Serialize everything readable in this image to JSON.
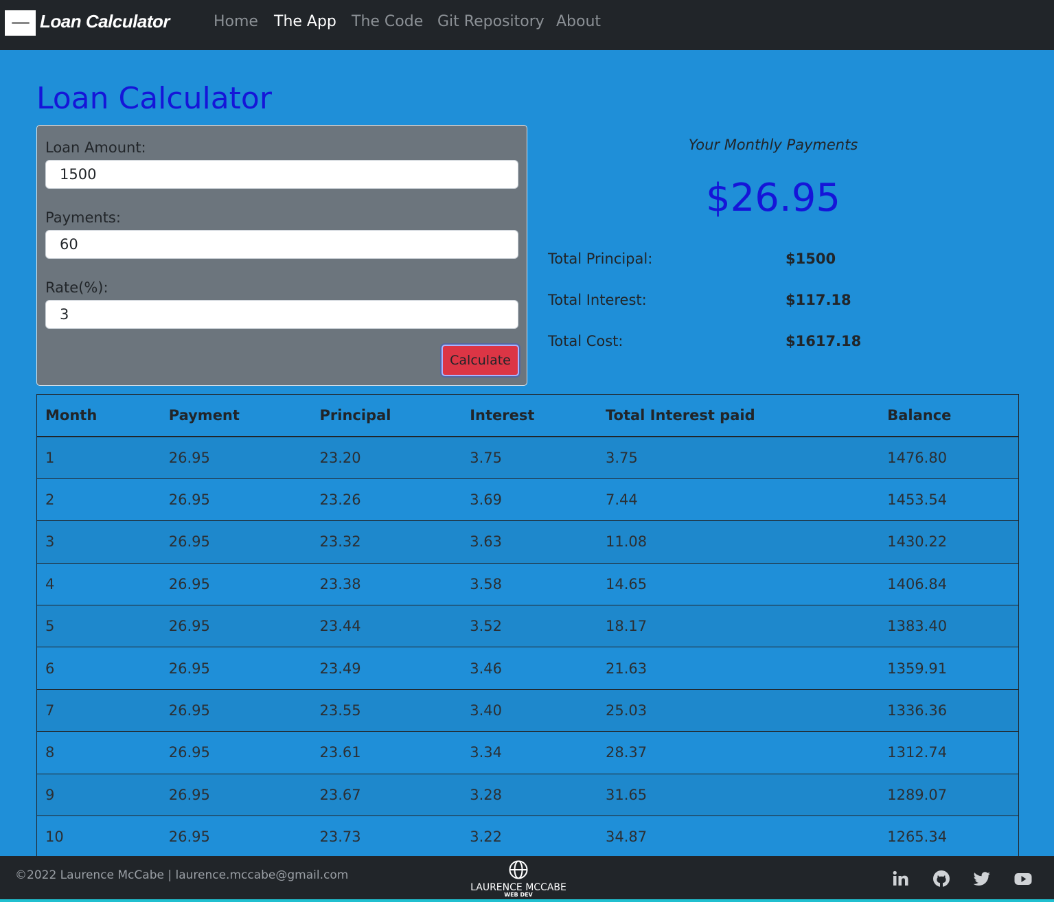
{
  "nav": {
    "brand": "Loan Calculator",
    "links": [
      "Home",
      "The App",
      "The Code",
      "Git Repository",
      "About"
    ],
    "active_index": 1
  },
  "page": {
    "title": "Loan Calculator"
  },
  "form": {
    "loan_amount_label": "Loan Amount:",
    "loan_amount_value": "1500",
    "payments_label": "Payments:",
    "payments_value": "60",
    "rate_label": "Rate(%):",
    "rate_value": "3",
    "calculate_label": "Calculate"
  },
  "results": {
    "caption": "Your Monthly Payments",
    "monthly_payment": "$26.95",
    "total_principal_label": "Total Principal:",
    "total_principal_value": "$1500",
    "total_interest_label": "Total Interest:",
    "total_interest_value": "$117.18",
    "total_cost_label": "Total Cost:",
    "total_cost_value": "$1617.18"
  },
  "table": {
    "headers": [
      "Month",
      "Payment",
      "Principal",
      "Interest",
      "Total Interest paid",
      "Balance"
    ],
    "rows": [
      [
        "1",
        "26.95",
        "23.20",
        "3.75",
        "3.75",
        "1476.80"
      ],
      [
        "2",
        "26.95",
        "23.26",
        "3.69",
        "7.44",
        "1453.54"
      ],
      [
        "3",
        "26.95",
        "23.32",
        "3.63",
        "11.08",
        "1430.22"
      ],
      [
        "4",
        "26.95",
        "23.38",
        "3.58",
        "14.65",
        "1406.84"
      ],
      [
        "5",
        "26.95",
        "23.44",
        "3.52",
        "18.17",
        "1383.40"
      ],
      [
        "6",
        "26.95",
        "23.49",
        "3.46",
        "21.63",
        "1359.91"
      ],
      [
        "7",
        "26.95",
        "23.55",
        "3.40",
        "25.03",
        "1336.36"
      ],
      [
        "8",
        "26.95",
        "23.61",
        "3.34",
        "28.37",
        "1312.74"
      ],
      [
        "9",
        "26.95",
        "23.67",
        "3.28",
        "31.65",
        "1289.07"
      ],
      [
        "10",
        "26.95",
        "23.73",
        "3.22",
        "34.87",
        "1265.34"
      ]
    ]
  },
  "footer": {
    "copyright": "©2022 Laurence McCabe | laurence.mccabe@gmail.com",
    "logo_name": "LAURENCE MCCABE",
    "logo_sub": "WEB DEV",
    "social_icons": [
      "linkedin-icon",
      "github-icon",
      "twitter-icon",
      "youtube-icon"
    ]
  },
  "colors": {
    "background": "#1f8fd8",
    "navbar": "#212529",
    "title": "#1515d8",
    "panel": "#6c757d",
    "button": "#dc3545"
  }
}
